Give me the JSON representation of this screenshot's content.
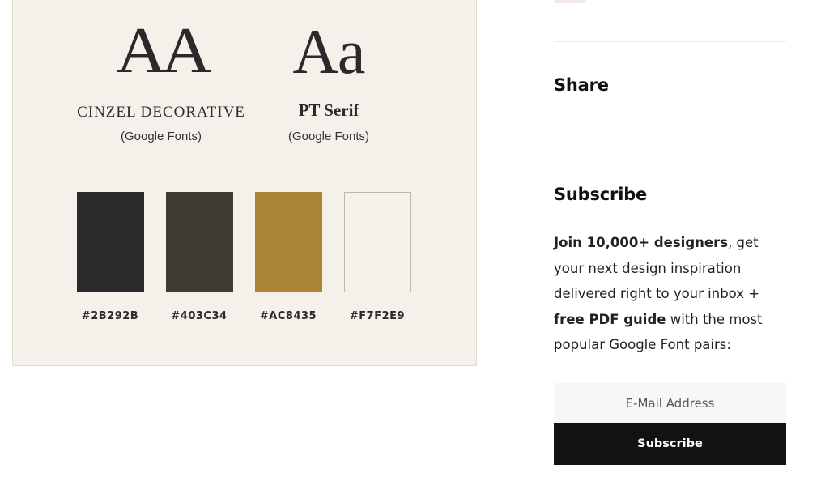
{
  "palette": {
    "fonts": [
      {
        "specimen": "AA",
        "name": "Cinzel Decorative",
        "source": "(Google Fonts)"
      },
      {
        "specimen": "Aa",
        "name": "PT Serif",
        "source": "(Google Fonts)"
      }
    ],
    "swatches": [
      {
        "color": "#2B292B",
        "label": "#2B292B"
      },
      {
        "color": "#403C34",
        "label": "#403C34"
      },
      {
        "color": "#AC8435",
        "label": "#AC8435"
      },
      {
        "color": "#F7F2E9",
        "label": "#F7F2E9"
      }
    ],
    "card_background": "#F5F0E9"
  },
  "sidebar": {
    "share_heading": "Share",
    "subscribe_heading": "Subscribe",
    "subscribe_text": {
      "bold_1": "Join 10,000+ designers",
      "text_1": ", get your next design inspiration delivered right to your inbox + ",
      "bold_2": "free PDF guide",
      "text_2": " with the most popular Google Font pairs:"
    },
    "email_placeholder": "E-Mail Address",
    "subscribe_button": "Subscribe"
  }
}
